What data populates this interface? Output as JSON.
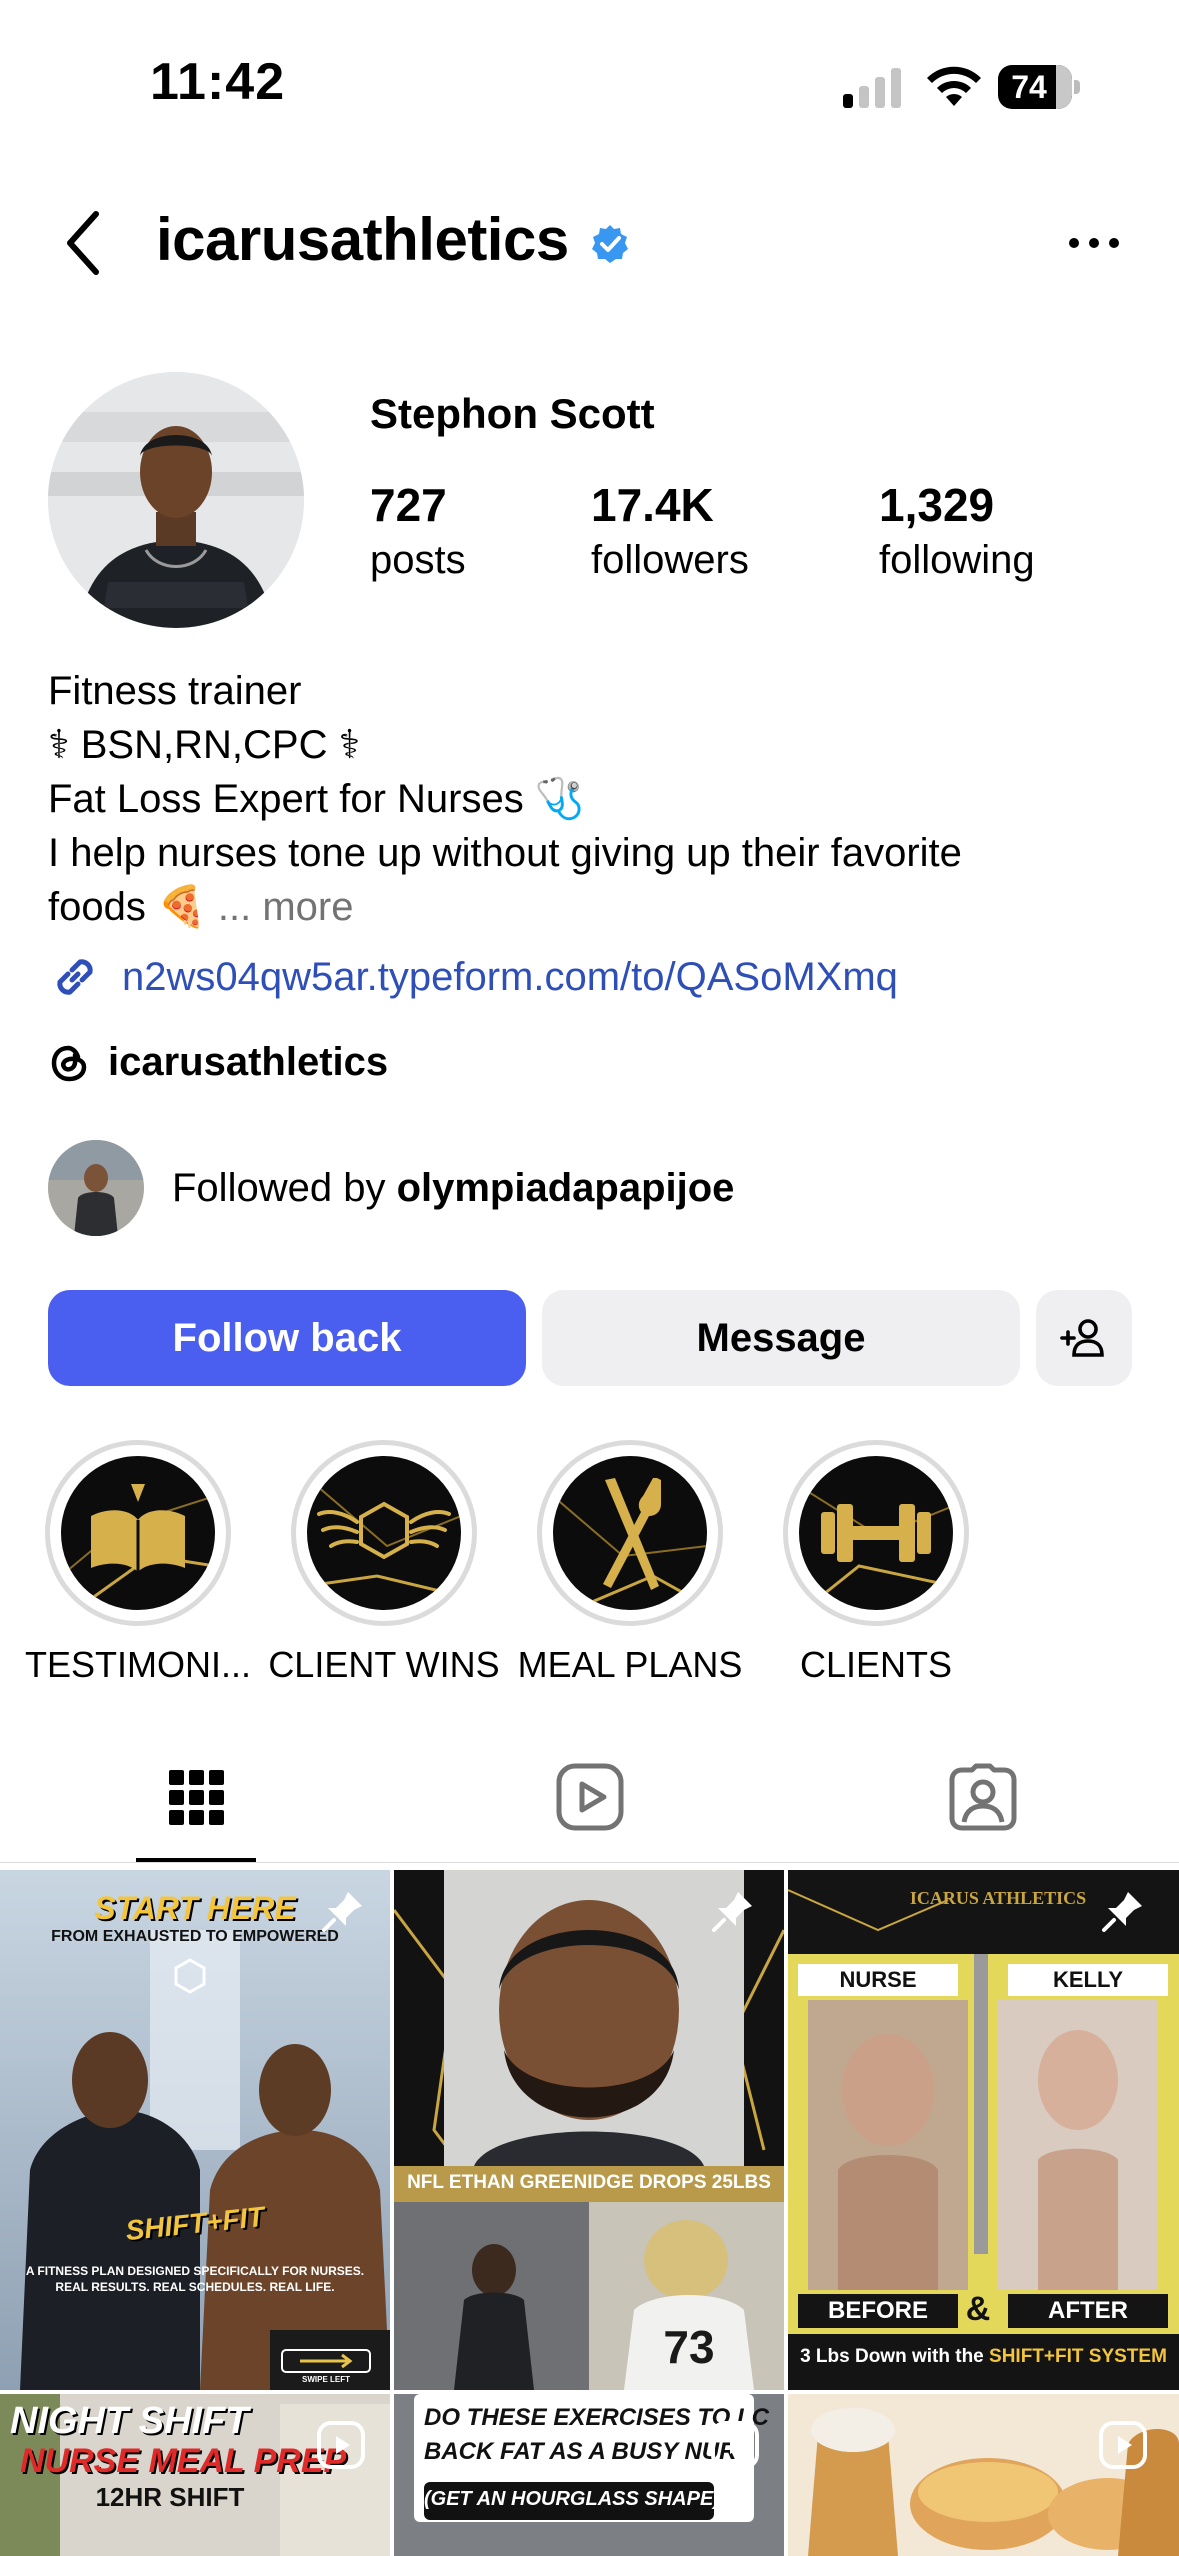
{
  "status_bar": {
    "time": "11:42",
    "battery": "74"
  },
  "header": {
    "username": "icarusathletics"
  },
  "profile": {
    "full_name": "Stephon Scott",
    "stats": [
      {
        "value": "727",
        "label": "posts"
      },
      {
        "value": "17.4K",
        "label": "followers"
      },
      {
        "value": "1,329",
        "label": "following"
      }
    ],
    "category": "Fitness trainer",
    "bio_lines": [
      "⚕ BSN,RN,CPC ⚕",
      "Fat Loss Expert for Nurses 🩺",
      "I help nurses tone up without giving up their favorite",
      "foods 🍕"
    ],
    "bio_more": "... more",
    "link": "n2ws04qw5ar.typeform.com/to/QASoMXmq",
    "threads_handle": "icarusathletics",
    "followed_by_prefix": "Followed by ",
    "followed_by_name": "olympiadapapijoe"
  },
  "actions": {
    "follow_back": "Follow back",
    "message": "Message"
  },
  "highlights": [
    {
      "label": "TESTIMONI...",
      "icon": "book-icon"
    },
    {
      "label": "CLIENT WINS",
      "icon": "wings-icon"
    },
    {
      "label": "MEAL PLANS",
      "icon": "fork-knife-icon"
    },
    {
      "label": "CLIENTS",
      "icon": "dumbbell-icon"
    }
  ],
  "posts": {
    "p1": {
      "top": "START HERE",
      "sub": "FROM EXHAUSTED TO EMPOWERED",
      "brand": "SHIFT+FIT",
      "cap1": "A FITNESS PLAN DESIGNED SPECIFICALLY FOR NURSES.",
      "cap2": "REAL RESULTS. REAL SCHEDULES. REAL LIFE.",
      "swipe": "SWIPE LEFT"
    },
    "p2": {
      "banner": "NFL ETHAN GREENIDGE DROPS 25LBS",
      "jersey": "73"
    },
    "p3": {
      "brand": "ICARUS ATHLETICS",
      "left": "NURSE",
      "right": "KELLY",
      "before": "BEFORE",
      "amp": "&",
      "after": "AFTER",
      "caption_a": "3 Lbs Down with the ",
      "caption_b": "SHIFT+FIT SYSTEM"
    },
    "p4": {
      "l1": "NIGHT SHIFT",
      "l2": "NURSE MEAL PREP",
      "l3": "12HR SHIFT"
    },
    "p5": {
      "l1": "DO THESE EXERCISES TO LC",
      "l2": "BACK FAT AS A BUSY NUR",
      "l3": "(GET AN HOURGLASS SHAPE)"
    }
  },
  "colors": {
    "follow_button": "#4a5ef0",
    "link": "#2f4fb8",
    "verified": "#3897f0",
    "gold": "#c9a640"
  }
}
